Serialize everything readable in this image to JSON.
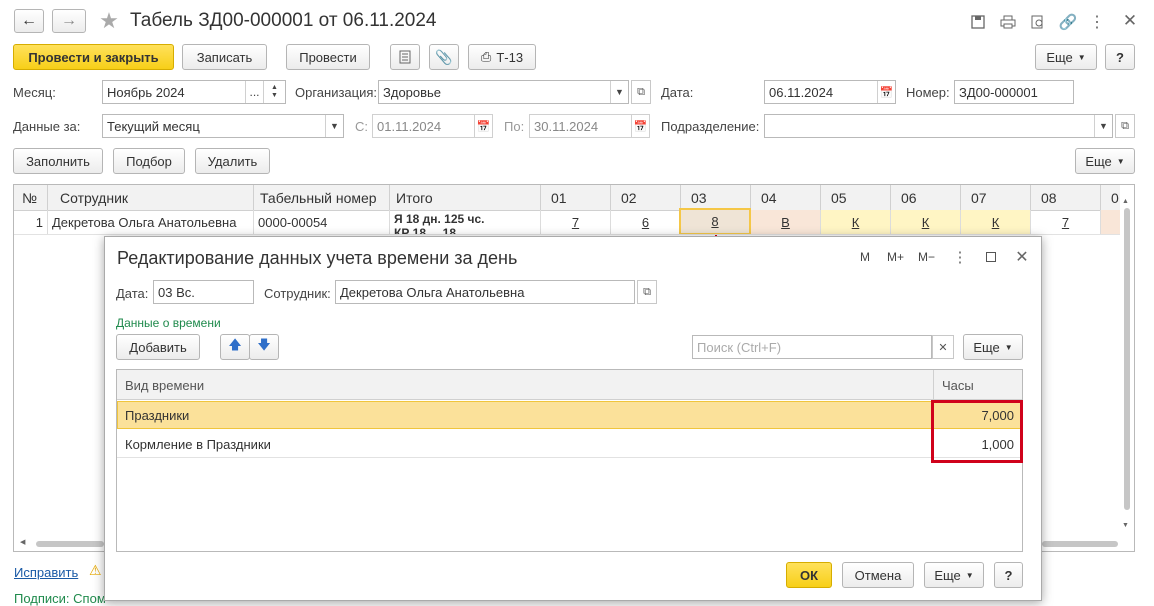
{
  "window": {
    "title": "Табель ЗД00-000001 от 06.11.2024"
  },
  "toolbar": {
    "post_close": "Провести и закрыть",
    "write": "Записать",
    "post": "Провести",
    "t13": "Т-13",
    "more": "Еще",
    "help": "?"
  },
  "form": {
    "month_label": "Месяц:",
    "month_value": "Ноябрь 2024",
    "org_label": "Организация:",
    "org_value": "Здоровье",
    "date_label": "Дата:",
    "date_value": "06.11.2024",
    "number_label": "Номер:",
    "number_value": "ЗД00-000001",
    "data_for_label": "Данные за:",
    "data_for_value": "Текущий месяц",
    "from_label": "С:",
    "from_value": "01.11.2024",
    "to_label": "По:",
    "to_value": "30.11.2024",
    "dept_label": "Подразделение:",
    "dept_value": ""
  },
  "table_toolbar": {
    "fill": "Заполнить",
    "select": "Подбор",
    "delete": "Удалить",
    "more": "Еще"
  },
  "table": {
    "headers": [
      "№",
      "Сотрудник",
      "Табельный номер",
      "Итого",
      "01",
      "02",
      "03",
      "04",
      "05",
      "06",
      "07",
      "08",
      "0"
    ],
    "row": {
      "num": "1",
      "employee": "Декретова Ольга Анатольевна",
      "tab_number": "0000-00054",
      "total_line1": "Я 18 дн. 125 чс.",
      "total_line2": "КР 18 ... 18 ...",
      "days": [
        "7",
        "6",
        "8",
        "В",
        "К",
        "К",
        "К",
        "7"
      ]
    }
  },
  "footer": {
    "fix_link": "Исправить",
    "signatures": "Подписи: Спом"
  },
  "dialog": {
    "title": "Редактирование данных учета времени за день",
    "hdr_m": "M",
    "hdr_mplus": "M+",
    "hdr_mminus": "M−",
    "date_label": "Дата:",
    "date_value": "03 Вс.",
    "employee_label": "Сотрудник:",
    "employee_value": "Декретова Ольга Анатольевна",
    "section": "Данные о времени",
    "add": "Добавить",
    "search_placeholder": "Поиск (Ctrl+F)",
    "more": "Еще",
    "col_kind": "Вид времени",
    "col_hours": "Часы",
    "rows": [
      {
        "kind": "Праздники",
        "hours": "7,000"
      },
      {
        "kind": "Кормление в Праздники",
        "hours": "1,000"
      }
    ],
    "ok": "ОК",
    "cancel": "Отмена",
    "help": "?"
  },
  "colors": {
    "accent_yellow": "#f7cf18",
    "highlight_red": "#d0021b",
    "section_green": "#1f8a4c",
    "link_blue": "#1a5aa6"
  }
}
